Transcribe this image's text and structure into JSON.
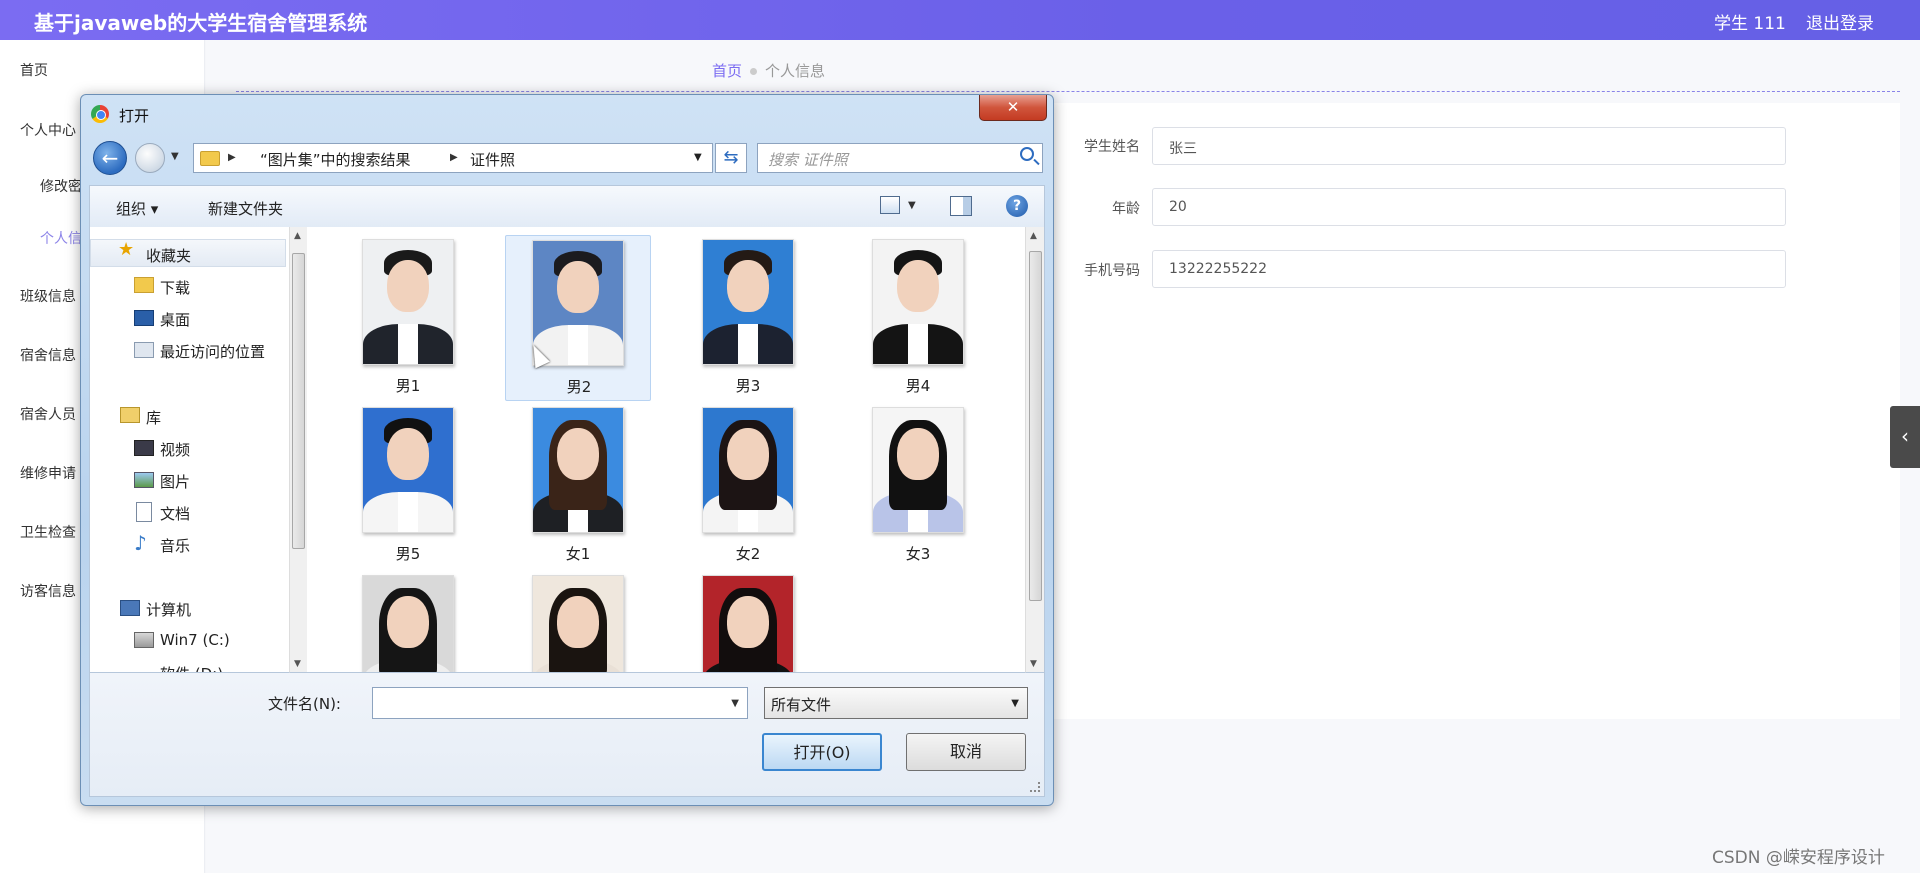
{
  "header": {
    "title": "基于javaweb的大学生宿舍管理系统",
    "user": "学生 111",
    "logout": "退出登录"
  },
  "sidebar": {
    "items": [
      "首页",
      "个人中心",
      "修改密",
      "个人信",
      "班级信息",
      "宿舍信息",
      "宿舍人员",
      "维修申请",
      "卫生检查",
      "访客信息"
    ]
  },
  "breadcrumb": {
    "home": "首页",
    "current": "个人信息"
  },
  "form": {
    "fields": [
      {
        "label": "学生姓名",
        "value": "张三"
      },
      {
        "label": "年龄",
        "value": "20"
      },
      {
        "label": "手机号码",
        "value": "13222255222"
      }
    ]
  },
  "dialog": {
    "title": "打开",
    "close": "✕",
    "address": {
      "seg1": "“图片集”中的搜索结果",
      "seg2": "证件照"
    },
    "search_placeholder": "搜索 证件照",
    "toolbar": {
      "organize": "组织 ▾",
      "new_folder": "新建文件夹",
      "help": "?"
    },
    "nav": {
      "favorites": "收藏夹",
      "downloads": "下载",
      "desktop": "桌面",
      "recent": "最近访问的位置",
      "libraries": "库",
      "videos": "视频",
      "pictures": "图片",
      "documents": "文档",
      "music": "音乐",
      "computer": "计算机",
      "drive_c": "Win7 (C:)",
      "drive_d": "软件 (D:)"
    },
    "files": [
      {
        "name": "男1",
        "bg": "#eef0f2",
        "hair": "#1a1a1a",
        "suit": "#20242c",
        "long": false
      },
      {
        "name": "男2",
        "bg": "#5d86c4",
        "hair": "#1b1b1f",
        "suit": "#f2f2f2",
        "long": false
      },
      {
        "name": "男3",
        "bg": "#2f7fd3",
        "hair": "#241a15",
        "suit": "#1c2230",
        "long": false
      },
      {
        "name": "男4",
        "bg": "#f3f3f3",
        "hair": "#151515",
        "suit": "#141414",
        "long": false
      },
      {
        "name": "男5",
        "bg": "#2f6fcf",
        "hair": "#111",
        "suit": "#f5f5f5",
        "long": false
      },
      {
        "name": "女1",
        "bg": "#3b8be0",
        "hair": "#3a2418",
        "suit": "#1e2024",
        "long": true
      },
      {
        "name": "女2",
        "bg": "#2d78cf",
        "hair": "#1c1414",
        "suit": "#f4f4f4",
        "long": true
      },
      {
        "name": "女3",
        "bg": "#f5f5f5",
        "hair": "#111",
        "suit": "#b9c4e8",
        "long": true
      },
      {
        "name": "",
        "bg": "#d9d9d9",
        "hair": "#151515",
        "suit": "#eee",
        "long": true
      },
      {
        "name": "",
        "bg": "#efe7dd",
        "hair": "#1a1410",
        "suit": "#e9e0d6",
        "long": true
      },
      {
        "name": "",
        "bg": "#b3242a",
        "hair": "#120d0d",
        "suit": "#111",
        "long": true
      }
    ],
    "filename_label": "文件名(N):",
    "filename_value": "",
    "filetype": "所有文件",
    "open_button": "打开(O)",
    "cancel_button": "取消"
  },
  "watermark": "CSDN @嵘安程序设计"
}
